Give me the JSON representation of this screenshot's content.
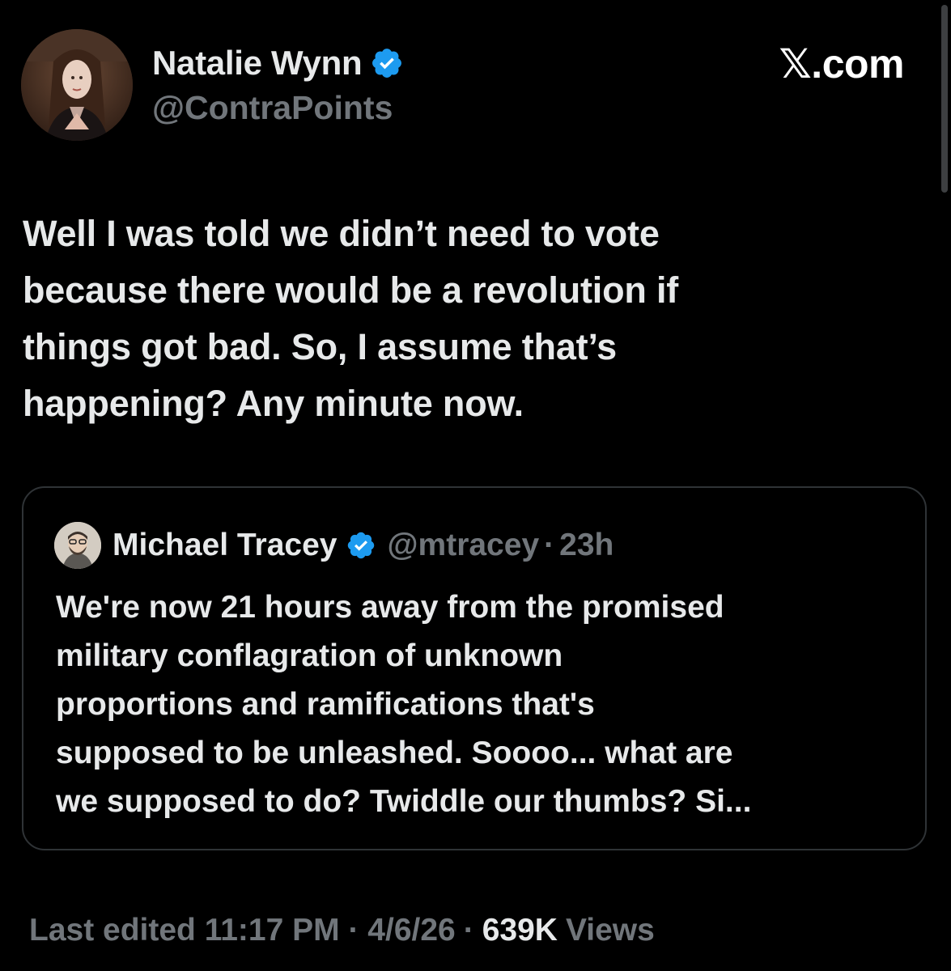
{
  "author": {
    "name": "Natalie Wynn",
    "handle": "@ContraPoints"
  },
  "site_logo": "𝕏.com",
  "tweet": {
    "lines": [
      "Well I was told we didn’t need to vote",
      "because there would be a revolution if",
      "things got bad. So, I assume that’s",
      "happening? Any minute now."
    ]
  },
  "quote": {
    "name": "Michael Tracey",
    "handle": "@mtracey",
    "dot": "·",
    "time": "23h",
    "lines": [
      "We're now 21 hours away from the promised",
      "military conflagration of unknown",
      "proportions and ramifications that's",
      "supposed to be unleashed. Soooo... what are",
      "we supposed to do? Twiddle our thumbs? Si..."
    ]
  },
  "meta": {
    "edited": "Last edited 11:17 PM · 4/6/26",
    "sep": "·",
    "views_count": "639K",
    "views_label": "Views"
  },
  "colors": {
    "background": "#000000",
    "primary_text": "#e7e9ea",
    "secondary_text": "#71767b",
    "verified_blue": "#1d9bf0",
    "card_border": "#2f3336"
  },
  "icons": {
    "verified": "verified-badge-icon",
    "logo": "x-logo"
  }
}
